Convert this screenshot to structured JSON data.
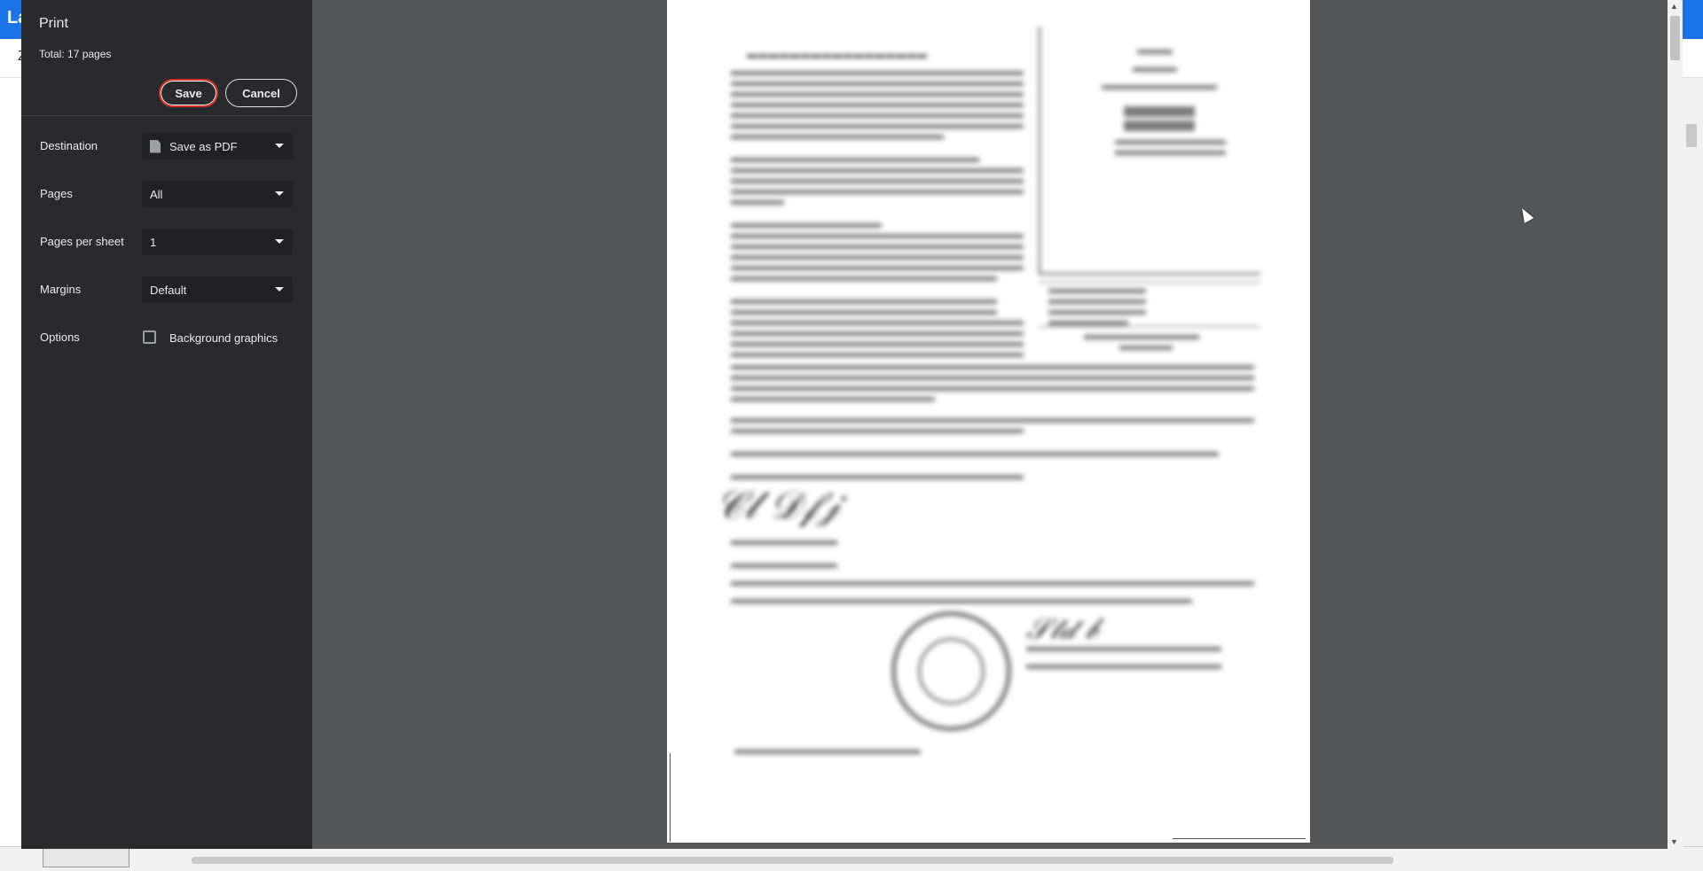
{
  "background": {
    "top_bar_text": "La",
    "second_bar_text": "Z",
    "right_arrow": "›"
  },
  "dialog": {
    "title": "Print",
    "total": "Total: 17 pages",
    "save_label": "Save",
    "cancel_label": "Cancel",
    "destination": {
      "label": "Destination",
      "value": "Save as PDF"
    },
    "pages": {
      "label": "Pages",
      "value": "All"
    },
    "pages_per_sheet": {
      "label": "Pages per sheet",
      "value": "1"
    },
    "margins": {
      "label": "Margins",
      "value": "Default"
    },
    "options": {
      "label": "Options",
      "checkbox_label": "Background graphics",
      "checked": false
    }
  },
  "colors": {
    "sidebar_bg": "#292a2d",
    "preview_bg": "#525659",
    "accent_red": "#d93025",
    "browser_blue": "#1a73e8"
  }
}
